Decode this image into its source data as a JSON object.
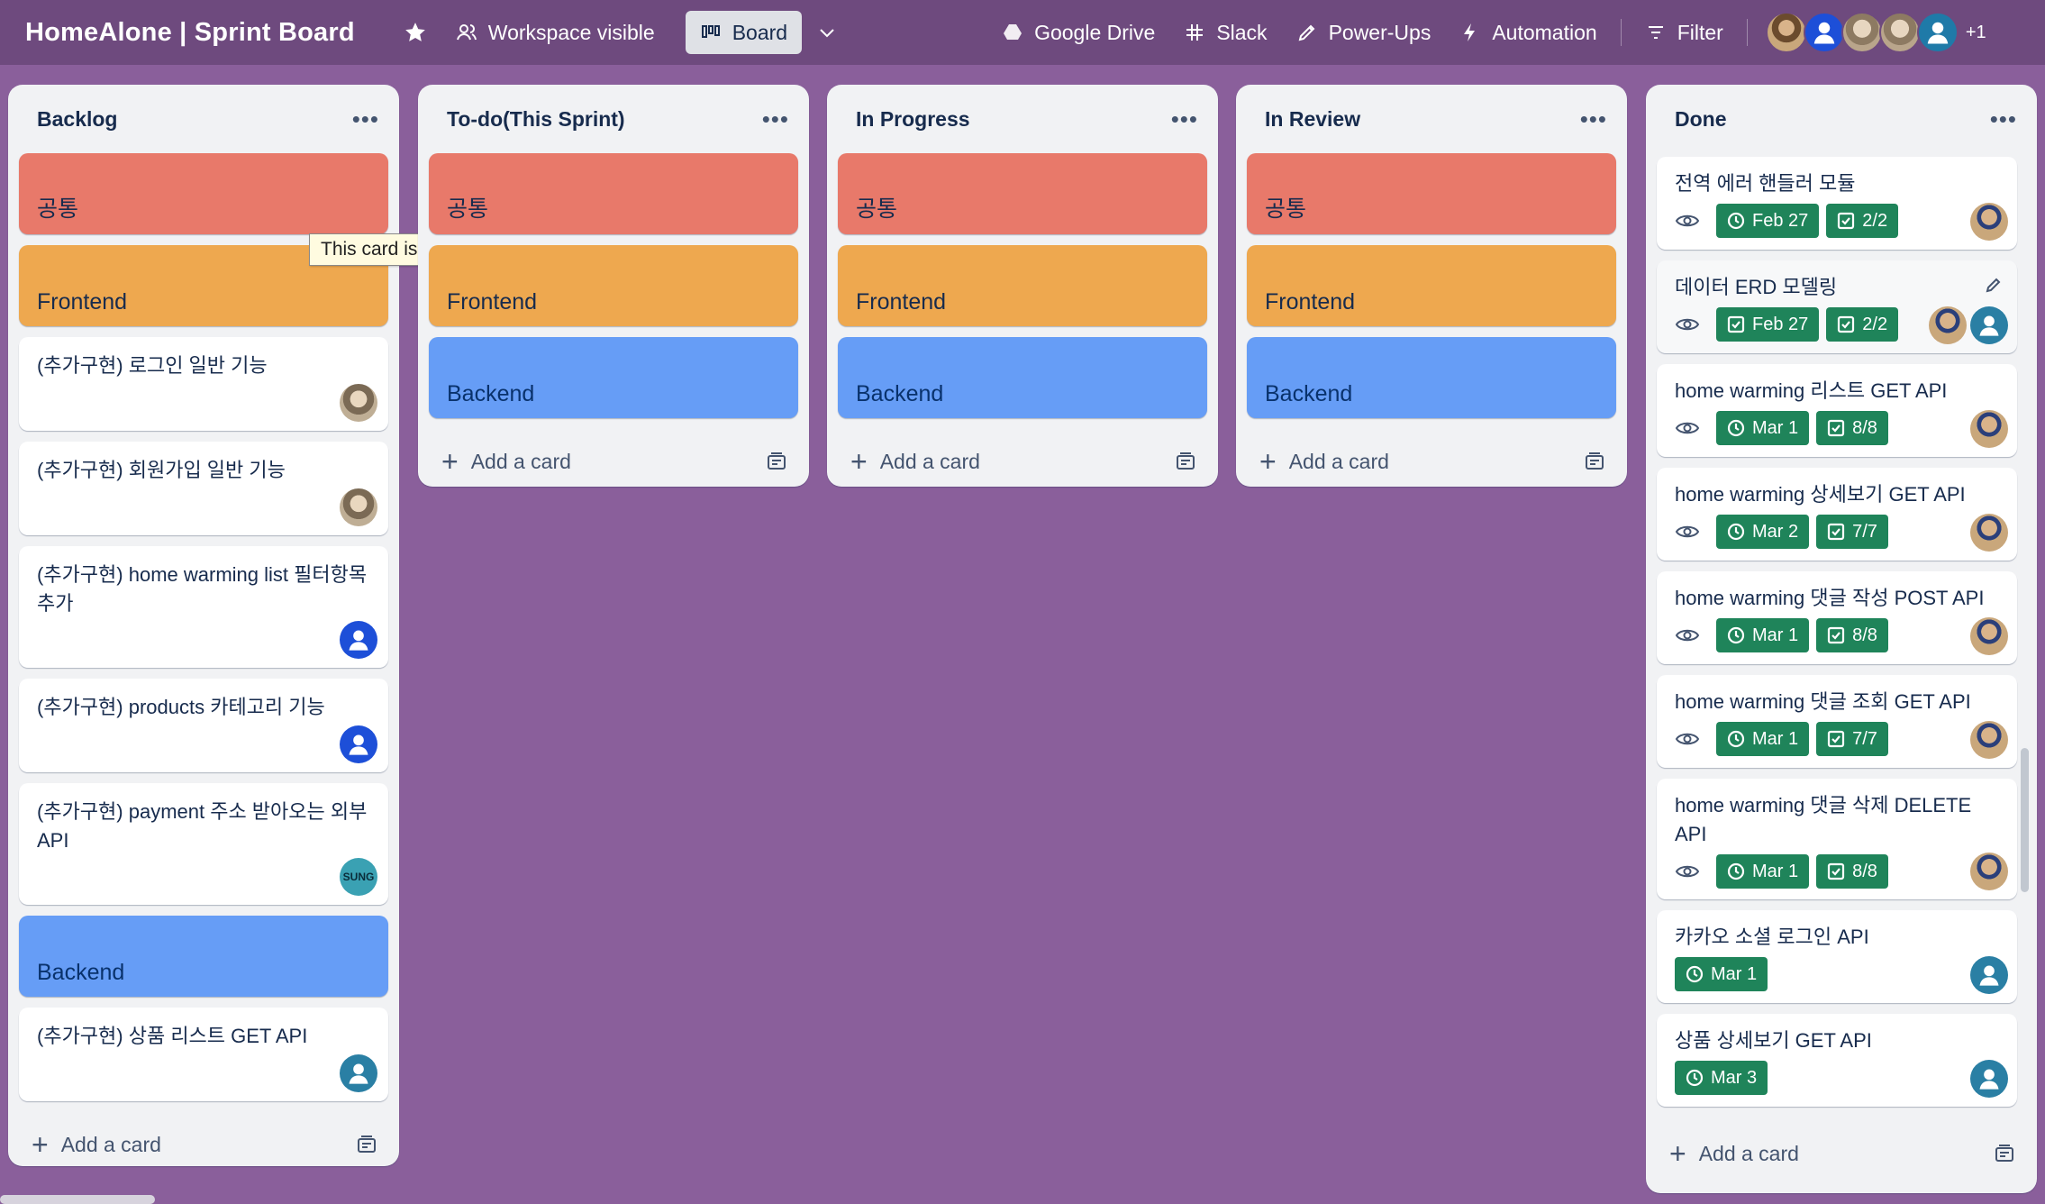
{
  "header": {
    "title": "HomeAlone | Sprint Board",
    "workspace": "Workspace visible",
    "board": "Board",
    "google_drive": "Google Drive",
    "slack": "Slack",
    "power_ups": "Power-Ups",
    "automation": "Automation",
    "filter": "Filter",
    "more_members": "+1"
  },
  "tooltip": "This card is complete.",
  "labels": {
    "common": "공통",
    "frontend": "Frontend",
    "backend": "Backend"
  },
  "add_card": "Add a card",
  "lists": {
    "backlog": {
      "title": "Backlog",
      "cards": [
        "(추가구현) 로그인 일반 기능",
        "(추가구현) 회원가입 일반 기능",
        "(추가구현) home warming list 필터항목 추가",
        "(추가구현) products 카테고리 기능",
        "(추가구현) payment 주소 받아오는 외부 API",
        "(추가구현) 상품 리스트 GET API"
      ],
      "sung": "SUNG"
    },
    "todo": {
      "title": "To-do(This Sprint)"
    },
    "in_progress": {
      "title": "In Progress"
    },
    "in_review": {
      "title": "In Review"
    },
    "done": {
      "title": "Done",
      "cards": [
        {
          "title": "전역 에러 핸들러 모듈",
          "date": "Feb 27",
          "check": "2/2"
        },
        {
          "title": "데이터 ERD 모델링",
          "date": "Feb 27",
          "check": "2/2"
        },
        {
          "title": "home warming 리스트 GET API",
          "date": "Mar 1",
          "check": "8/8"
        },
        {
          "title": "home warming 상세보기 GET API",
          "date": "Mar 2",
          "check": "7/7"
        },
        {
          "title": "home warming 댓글 작성 POST API",
          "date": "Mar 1",
          "check": "8/8"
        },
        {
          "title": "home warming 댓글 조회 GET API",
          "date": "Mar 1",
          "check": "7/7"
        },
        {
          "title": "home warming 댓글 삭제 DELETE API",
          "date": "Mar 1",
          "check": "8/8"
        },
        {
          "title": "카카오 소셜 로그인 API",
          "date": "Mar 1"
        },
        {
          "title": "상품 상세보기 GET API",
          "date": "Mar 3"
        }
      ]
    }
  }
}
